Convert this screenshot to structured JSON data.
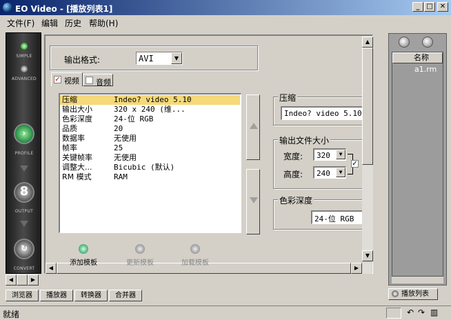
{
  "window": {
    "title": "EO Video - [播放列表1]",
    "min": "_",
    "max": "□",
    "close": "✕"
  },
  "menu": [
    "文件(F)",
    "编辑",
    "历史",
    "帮助(H)"
  ],
  "leftnav": {
    "simple": "SIMPLE",
    "advanced": "ADVANCED",
    "profile": "PROFILE",
    "output": "OUTPUT",
    "convert": "CONVERT",
    "output_glyph": "8"
  },
  "format": {
    "label": "输出格式:",
    "value": "AVI"
  },
  "tabs": [
    {
      "label": "视频",
      "checked": true
    },
    {
      "label": "音频",
      "checked": false
    }
  ],
  "properties": [
    {
      "key": "压缩",
      "value": "Indeo? video 5.10"
    },
    {
      "key": "输出大小",
      "value": "320 x 240 (维..."
    },
    {
      "key": "色彩深度",
      "value": "24-位 RGB"
    },
    {
      "key": "品质",
      "value": "20"
    },
    {
      "key": "数据率",
      "value": "无使用"
    },
    {
      "key": "帧率",
      "value": "25"
    },
    {
      "key": "关键帧率",
      "value": "无使用"
    },
    {
      "key": "调整大...",
      "value": "Bicubic (默认)"
    },
    {
      "key": "RM 模式",
      "value": "RAM"
    }
  ],
  "compression": {
    "title": "压缩",
    "value": "Indeo? video 5.10"
  },
  "output_size": {
    "title": "输出文件大小",
    "width_label": "宽度:",
    "width": "320",
    "height_label": "高度:",
    "height": "240"
  },
  "color_depth": {
    "title": "色彩深度",
    "value": "24-位 RGB"
  },
  "templates": {
    "add": "添加模板",
    "update": "更新模板",
    "load": "加载模板"
  },
  "bottom_tabs": [
    "浏览器",
    "播放器",
    "转换器",
    "合并器"
  ],
  "playlist": {
    "column": "名称",
    "item": "a1.rm",
    "tab": "播放列表"
  },
  "status": "就绪",
  "colors": {
    "titlebar": "#0a246a",
    "selection": "#f5d97a",
    "face": "#d4d0c8"
  }
}
